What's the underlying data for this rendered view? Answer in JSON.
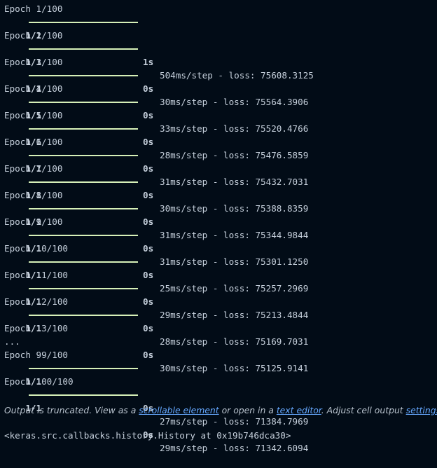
{
  "epochs": [
    {
      "epoch": "Epoch 1/100",
      "steps": "1/1",
      "time": "1s",
      "detail": "504ms/step - loss: 75608.3125"
    },
    {
      "epoch": "Epoch 2/100",
      "steps": "1/1",
      "time": "0s",
      "detail": "30ms/step - loss: 75564.3906"
    },
    {
      "epoch": "Epoch 3/100",
      "steps": "1/1",
      "time": "0s",
      "detail": "33ms/step - loss: 75520.4766"
    },
    {
      "epoch": "Epoch 4/100",
      "steps": "1/1",
      "time": "0s",
      "detail": "28ms/step - loss: 75476.5859"
    },
    {
      "epoch": "Epoch 5/100",
      "steps": "1/1",
      "time": "0s",
      "detail": "31ms/step - loss: 75432.7031"
    },
    {
      "epoch": "Epoch 6/100",
      "steps": "1/1",
      "time": "0s",
      "detail": "30ms/step - loss: 75388.8359"
    },
    {
      "epoch": "Epoch 7/100",
      "steps": "1/1",
      "time": "0s",
      "detail": "31ms/step - loss: 75344.9844"
    },
    {
      "epoch": "Epoch 8/100",
      "steps": "1/1",
      "time": "0s",
      "detail": "31ms/step - loss: 75301.1250"
    },
    {
      "epoch": "Epoch 9/100",
      "steps": "1/1",
      "time": "0s",
      "detail": "25ms/step - loss: 75257.2969"
    },
    {
      "epoch": "Epoch 10/100",
      "steps": "1/1",
      "time": "0s",
      "detail": "29ms/step - loss: 75213.4844"
    },
    {
      "epoch": "Epoch 11/100",
      "steps": "1/1",
      "time": "0s",
      "detail": "28ms/step - loss: 75169.7031"
    },
    {
      "epoch": "Epoch 12/100",
      "steps": "1/1",
      "time": "0s",
      "detail": "30ms/step - loss: 75125.9141"
    }
  ],
  "partial_epoch": "Epoch 13/100",
  "ellipsis": "...",
  "tail_epochs": [
    {
      "epoch": "Epoch 99/100",
      "steps": "1/1",
      "time": "0s",
      "detail": "27ms/step - loss: 71384.7969"
    },
    {
      "epoch": "Epoch 100/100",
      "steps": "1/1",
      "time": "0s",
      "detail": "29ms/step - loss: 71342.6094"
    }
  ],
  "truncation": {
    "prefix": "Output is truncated. View as a ",
    "scrollable_link": "scrollable element",
    "middle": " or open in a ",
    "editor_link": "text editor",
    "suffix": ". Adjust cell output ",
    "settings_link": "settings",
    "end": "..."
  },
  "result": "<keras.src.callbacks.history.History at 0x19b746dca30>",
  "colors": {
    "background": "#020c17",
    "progress_bar": "#d6f0b8",
    "link": "#66a8ff"
  }
}
